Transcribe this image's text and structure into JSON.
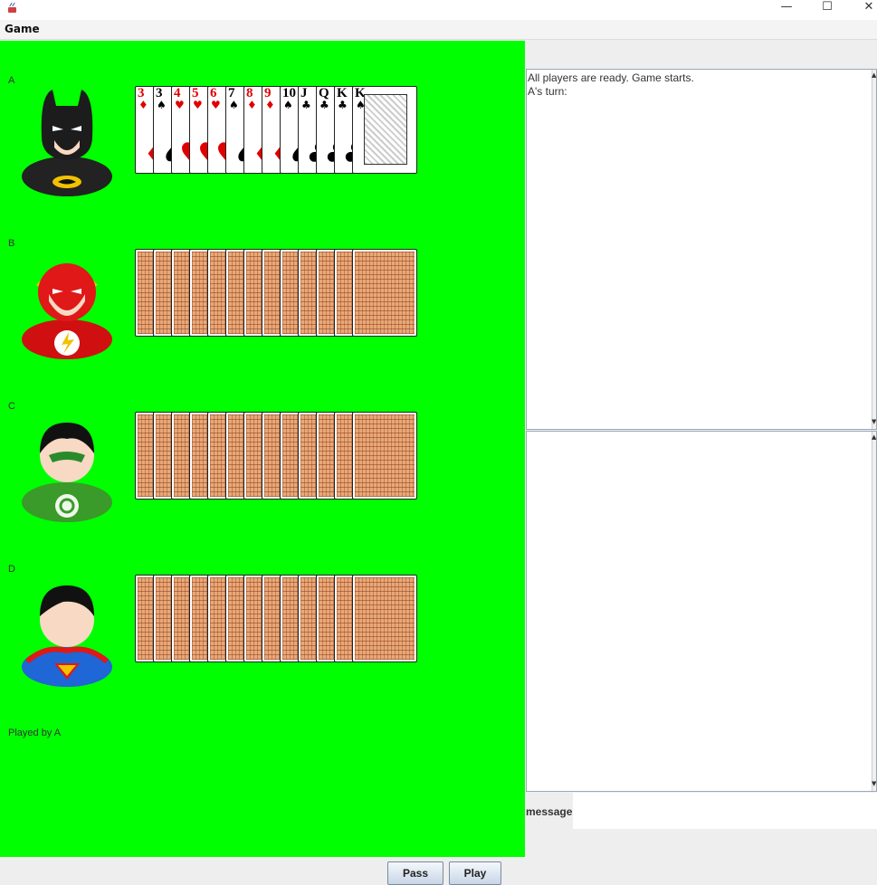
{
  "window": {
    "minimize": "—",
    "maximize": "☐",
    "close": "✕"
  },
  "menu": {
    "game": "Game"
  },
  "players": [
    {
      "name": "A",
      "hero": "batman-avatar",
      "cards_face_up": true,
      "cards": [
        {
          "rank": "3",
          "suit": "♦",
          "color": "red"
        },
        {
          "rank": "3",
          "suit": "♠",
          "color": "black"
        },
        {
          "rank": "4",
          "suit": "♥",
          "color": "red"
        },
        {
          "rank": "5",
          "suit": "♥",
          "color": "red"
        },
        {
          "rank": "6",
          "suit": "♥",
          "color": "red"
        },
        {
          "rank": "7",
          "suit": "♠",
          "color": "black"
        },
        {
          "rank": "8",
          "suit": "♦",
          "color": "red"
        },
        {
          "rank": "9",
          "suit": "♦",
          "color": "red"
        },
        {
          "rank": "10",
          "suit": "♠",
          "color": "black"
        },
        {
          "rank": "J",
          "suit": "♣",
          "color": "black"
        },
        {
          "rank": "Q",
          "suit": "♣",
          "color": "black"
        },
        {
          "rank": "K",
          "suit": "♣",
          "color": "black"
        },
        {
          "rank": "K",
          "suit": "♠",
          "color": "black"
        }
      ]
    },
    {
      "name": "B",
      "hero": "flash-avatar",
      "cards_face_up": false,
      "card_count": 13
    },
    {
      "name": "C",
      "hero": "green-lantern-avatar",
      "cards_face_up": false,
      "card_count": 13
    },
    {
      "name": "D",
      "hero": "superman-avatar",
      "cards_face_up": false,
      "card_count": 13
    }
  ],
  "played_label": "Played by A",
  "log": [
    "All players are ready. Game starts.",
    "A's turn:"
  ],
  "chat": {
    "message_label": "message",
    "message_value": ""
  },
  "buttons": {
    "pass": "Pass",
    "play": "Play"
  },
  "colors": {
    "table": "#00ff00",
    "card_back": "#e8a878"
  }
}
